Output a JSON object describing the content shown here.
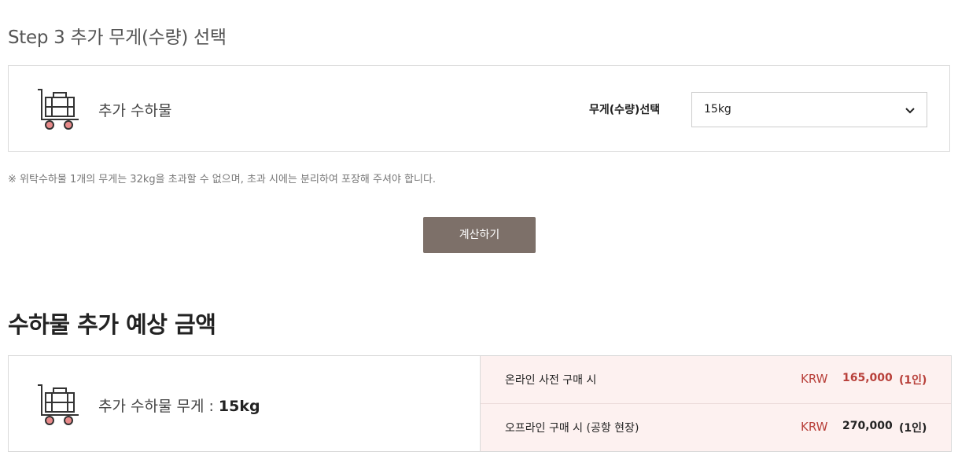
{
  "step": {
    "title": "Step 3 추가 무게(수량) 선택"
  },
  "selection": {
    "item_label": "추가 수하물",
    "weight_label": "무게(수량)선택",
    "selected_weight": "15kg",
    "notice": "※ 위탁수하물 1개의 무게는 32kg을 초과할 수 없으며, 초과 시에는 분리하여 포장해 주셔야 합니다."
  },
  "calc_button": {
    "label": "계산하기"
  },
  "estimate": {
    "section_title": "수하물 추가 예상 금액",
    "item_label": "추가 수하물 무게 : ",
    "item_weight": "15kg",
    "rows": [
      {
        "title": "온라인 사전 구매 시",
        "currency": "KRW",
        "amount": "165,000",
        "per": "(1인)"
      },
      {
        "title": "오프라인 구매 시 (공항 현장)",
        "currency": "KRW",
        "amount": "270,000",
        "per": "(1인)"
      }
    ]
  },
  "colors": {
    "button": "#7d7069",
    "accent": "#b8403a",
    "price_panel_bg": "#fdf1f0",
    "icon_wheel": "#e88a8a"
  },
  "icons": {
    "cart": "luggage-cart-icon",
    "dropdown": "chevron-down-icon"
  }
}
